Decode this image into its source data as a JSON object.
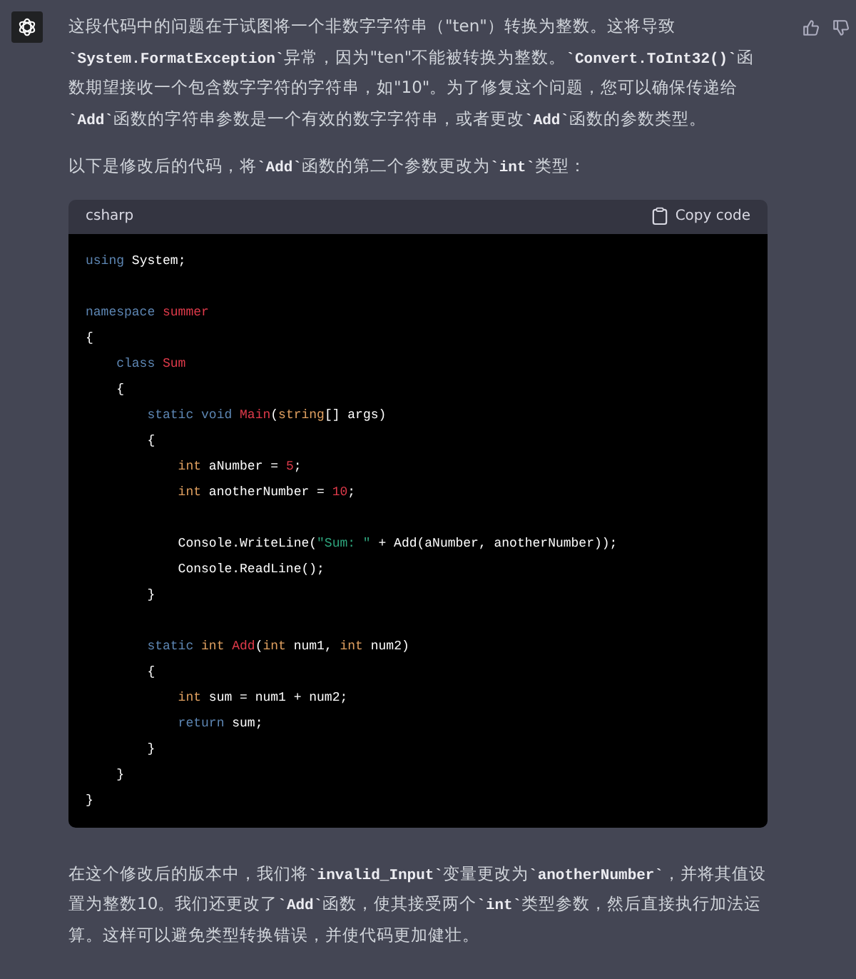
{
  "message": {
    "paragraphs_before": [
      "这段代码中的问题在于试图将一个非数字字符串（\"ten\"）转换为整数。这将导致**`System.FormatException`**异常，因为\"ten\"不能被转换为整数。**`Convert.ToInt32()`**函数期望接收一个包含数字字符的字符串，如\"10\"。为了修复这个问题，您可以确保传递给**`Add`**函数的字符串参数是一个有效的数字字符串，或者更改**`Add`**函数的参数类型。",
      "以下是修改后的代码，将**`Add`**函数的第二个参数更改为**`int`**类型："
    ],
    "code_block": {
      "language": "csharp",
      "copy_label": "Copy code",
      "lines": [
        {
          "kind": "code",
          "tokens": [
            {
              "kind": "kw",
              "s": "using"
            },
            {
              "kind": "plain",
              "s": " System;"
            }
          ]
        },
        {
          "kind": "blank"
        },
        {
          "kind": "code",
          "tokens": [
            {
              "kind": "kw",
              "s": "namespace"
            },
            {
              "kind": "name",
              "s": " summer"
            }
          ]
        },
        {
          "kind": "code",
          "tokens": [
            {
              "kind": "plain",
              "s": "{"
            }
          ]
        },
        {
          "kind": "code",
          "tokens": [
            {
              "kind": "kw",
              "s": "    class"
            },
            {
              "kind": "name",
              "s": " Sum"
            }
          ]
        },
        {
          "kind": "code",
          "tokens": [
            {
              "kind": "plain",
              "s": "    {"
            }
          ]
        },
        {
          "kind": "code",
          "tokens": [
            {
              "kind": "kw",
              "s": "        static void"
            },
            {
              "kind": "name",
              "s": " Main"
            },
            {
              "kind": "plain",
              "s": "("
            },
            {
              "kind": "type",
              "s": "string"
            },
            {
              "kind": "plain",
              "s": "[] args)"
            }
          ]
        },
        {
          "kind": "code",
          "tokens": [
            {
              "kind": "plain",
              "s": "        {"
            }
          ]
        },
        {
          "kind": "code",
          "tokens": [
            {
              "kind": "type",
              "s": "            int"
            },
            {
              "kind": "plain",
              "s": " aNumber = "
            },
            {
              "kind": "num",
              "s": "5"
            },
            {
              "kind": "plain",
              "s": ";"
            }
          ]
        },
        {
          "kind": "code",
          "tokens": [
            {
              "kind": "type",
              "s": "            int"
            },
            {
              "kind": "plain",
              "s": " anotherNumber = "
            },
            {
              "kind": "num",
              "s": "10"
            },
            {
              "kind": "plain",
              "s": ";"
            }
          ]
        },
        {
          "kind": "blank"
        },
        {
          "kind": "code",
          "tokens": [
            {
              "kind": "plain",
              "s": "            Console.WriteLine("
            },
            {
              "kind": "str",
              "s": "\"Sum: \""
            },
            {
              "kind": "plain",
              "s": " + Add(aNumber, anotherNumber));"
            }
          ]
        },
        {
          "kind": "code",
          "tokens": [
            {
              "kind": "plain",
              "s": "            Console.ReadLine();"
            }
          ]
        },
        {
          "kind": "code",
          "tokens": [
            {
              "kind": "plain",
              "s": "        }"
            }
          ]
        },
        {
          "kind": "blank"
        },
        {
          "kind": "code",
          "tokens": [
            {
              "kind": "kw",
              "s": "        static"
            },
            {
              "kind": "type",
              "s": " int"
            },
            {
              "kind": "name",
              "s": " Add"
            },
            {
              "kind": "plain",
              "s": "("
            },
            {
              "kind": "type",
              "s": "int"
            },
            {
              "kind": "plain",
              "s": " num1,"
            },
            {
              "kind": "type",
              "s": " int"
            },
            {
              "kind": "plain",
              "s": " num2)"
            }
          ]
        },
        {
          "kind": "code",
          "tokens": [
            {
              "kind": "plain",
              "s": "        {"
            }
          ]
        },
        {
          "kind": "code",
          "tokens": [
            {
              "kind": "type",
              "s": "            int"
            },
            {
              "kind": "plain",
              "s": " sum = num1 + num2;"
            }
          ]
        },
        {
          "kind": "code",
          "tokens": [
            {
              "kind": "kw",
              "s": "            return"
            },
            {
              "kind": "plain",
              "s": " sum;"
            }
          ]
        },
        {
          "kind": "code",
          "tokens": [
            {
              "kind": "plain",
              "s": "        }"
            }
          ]
        },
        {
          "kind": "code",
          "tokens": [
            {
              "kind": "plain",
              "s": "    }"
            }
          ]
        },
        {
          "kind": "code",
          "tokens": [
            {
              "kind": "plain",
              "s": "}"
            }
          ]
        }
      ]
    },
    "paragraphs_after": [
      "在这个修改后的版本中，我们将**`invalid_Input`**变量更改为**`anotherNumber`**，并将其值设置为整数10。我们还更改了**`Add`**函数，使其接受两个**`int`**类型参数，然后直接执行加法运算。这样可以避免类型转换错误，并使代码更加健壮。"
    ]
  }
}
